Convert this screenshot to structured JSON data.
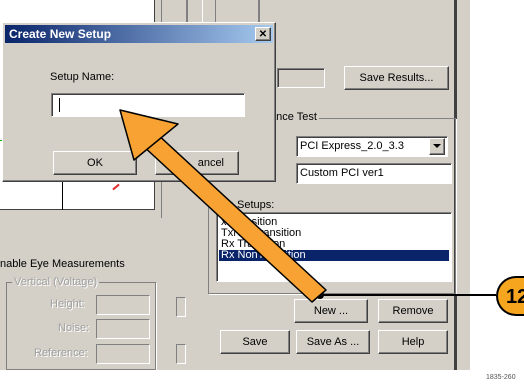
{
  "dialog": {
    "title": "Create New Setup",
    "close_glyph": "✕",
    "setup_name_label": "Setup Name:",
    "setup_name_value": "",
    "ok_label": "OK",
    "cancel_label": "Cancel",
    "cancel_visible": "ancel"
  },
  "main": {
    "save_results_label": "Save Results...",
    "compliance_group_label": "ance Test",
    "standard_select_value": "PCI Express_2.0_3.3",
    "custom_field_value": "Custom PCI ver1",
    "eye_setups_label": "Eye Setups:",
    "eye_setups_items": [
      {
        "label": "Tx Transition",
        "visible": "x Transition",
        "selected": false
      },
      {
        "label": "Tx NonTransition",
        "visible": "TxNonTransition",
        "selected": false
      },
      {
        "label": "Rx Transition",
        "visible": "Rx Transition",
        "selected": false
      },
      {
        "label": "Rx NonTransition",
        "visible": "Rx NonTransition",
        "selected": true
      }
    ],
    "new_label": "New ...",
    "remove_label": "Remove",
    "save_label": "Save",
    "save_as_label": "Save As ...",
    "help_label": "Help"
  },
  "left": {
    "eye_measurements_label": "nable Eye Measurements",
    "vertical_group_label": "Vertical (Voltage)",
    "height_label": "Height:",
    "noise_label": "Noise:",
    "reference_label": "Reference:"
  },
  "callout": {
    "number": "12",
    "color": "#f5a51e"
  },
  "figure_id": "1835-260",
  "colors": {
    "window": "#d4d0c8",
    "selection": "#0a246a",
    "title_bar_start": "#0a246a",
    "title_bar_end": "#a6caf0",
    "arrow_fill": "#f7a233"
  }
}
